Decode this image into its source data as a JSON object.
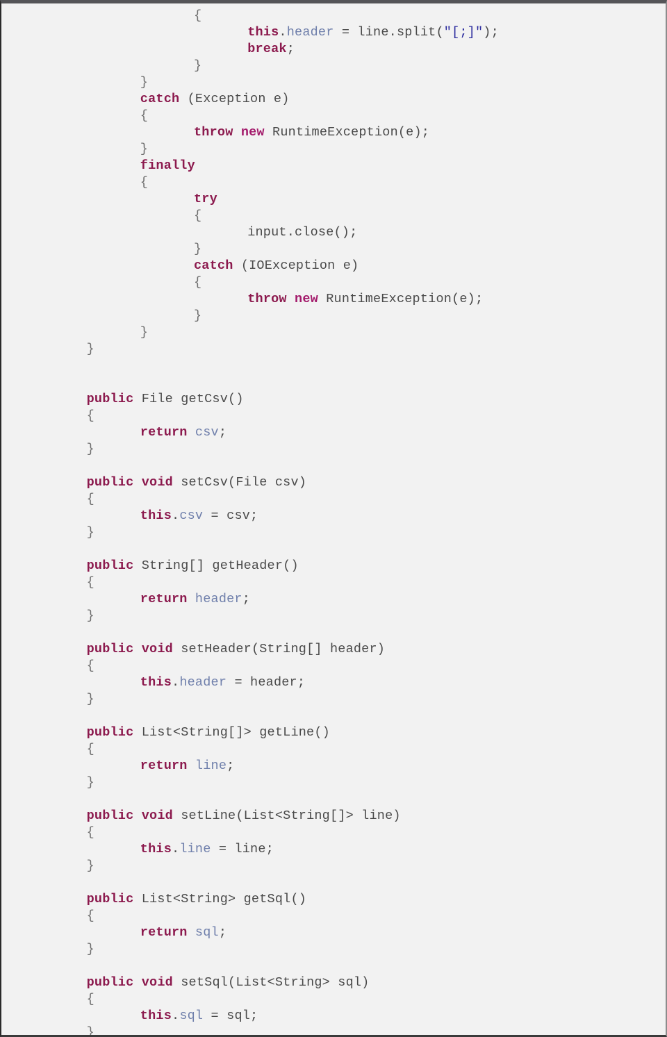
{
  "document": {
    "kind": "source-code-listing",
    "language": "Java",
    "colors": {
      "background": "#f2f2f2",
      "keyword": "#8c1a4e",
      "keyword_alt": "#a31a6b",
      "field": "#6f7fab",
      "string": "#2c2c9e",
      "plain": "#4a4a4a",
      "brace": "#6e6e6e",
      "border_top": "#555558"
    }
  },
  "code": {
    "lines": [
      {
        "indent": 10,
        "tokens": [
          {
            "t": "{",
            "c": "brc"
          }
        ]
      },
      {
        "indent": 14,
        "tokens": [
          {
            "t": "this",
            "c": "kw"
          },
          {
            "t": ".",
            "c": "pln"
          },
          {
            "t": "header",
            "c": "fld"
          },
          {
            "t": " = line.split(",
            "c": "pln"
          },
          {
            "t": "\"[;]\"",
            "c": "str"
          },
          {
            "t": ");",
            "c": "pln"
          }
        ]
      },
      {
        "indent": 14,
        "tokens": [
          {
            "t": "break",
            "c": "kw"
          },
          {
            "t": ";",
            "c": "pln"
          }
        ]
      },
      {
        "indent": 10,
        "tokens": [
          {
            "t": "}",
            "c": "brc"
          }
        ]
      },
      {
        "indent": 6,
        "tokens": [
          {
            "t": "}",
            "c": "brc"
          }
        ]
      },
      {
        "indent": 6,
        "tokens": [
          {
            "t": "catch",
            "c": "kw"
          },
          {
            "t": " (Exception e)",
            "c": "pln"
          }
        ]
      },
      {
        "indent": 6,
        "tokens": [
          {
            "t": "{",
            "c": "brc"
          }
        ]
      },
      {
        "indent": 10,
        "tokens": [
          {
            "t": "throw",
            "c": "kw"
          },
          {
            "t": " ",
            "c": "pln"
          },
          {
            "t": "new",
            "c": "kw2"
          },
          {
            "t": " RuntimeException(e);",
            "c": "pln"
          }
        ]
      },
      {
        "indent": 6,
        "tokens": [
          {
            "t": "}",
            "c": "brc"
          }
        ]
      },
      {
        "indent": 6,
        "tokens": [
          {
            "t": "finally",
            "c": "kw"
          }
        ]
      },
      {
        "indent": 6,
        "tokens": [
          {
            "t": "{",
            "c": "brc"
          }
        ]
      },
      {
        "indent": 10,
        "tokens": [
          {
            "t": "try",
            "c": "kw"
          }
        ]
      },
      {
        "indent": 10,
        "tokens": [
          {
            "t": "{",
            "c": "brc"
          }
        ]
      },
      {
        "indent": 14,
        "tokens": [
          {
            "t": "input.close();",
            "c": "pln"
          }
        ]
      },
      {
        "indent": 10,
        "tokens": [
          {
            "t": "}",
            "c": "brc"
          }
        ]
      },
      {
        "indent": 10,
        "tokens": [
          {
            "t": "catch",
            "c": "kw"
          },
          {
            "t": " (IOException e)",
            "c": "pln"
          }
        ]
      },
      {
        "indent": 10,
        "tokens": [
          {
            "t": "{",
            "c": "brc"
          }
        ]
      },
      {
        "indent": 14,
        "tokens": [
          {
            "t": "throw",
            "c": "kw"
          },
          {
            "t": " ",
            "c": "pln"
          },
          {
            "t": "new",
            "c": "kw2"
          },
          {
            "t": " RuntimeException(e);",
            "c": "pln"
          }
        ]
      },
      {
        "indent": 10,
        "tokens": [
          {
            "t": "}",
            "c": "brc"
          }
        ]
      },
      {
        "indent": 6,
        "tokens": [
          {
            "t": "}",
            "c": "brc"
          }
        ]
      },
      {
        "indent": 2,
        "tokens": [
          {
            "t": "}",
            "c": "brc"
          }
        ]
      },
      {
        "indent": 0,
        "tokens": []
      },
      {
        "indent": 0,
        "tokens": []
      },
      {
        "indent": 2,
        "tokens": [
          {
            "t": "public",
            "c": "kw"
          },
          {
            "t": " File getCsv()",
            "c": "typ"
          }
        ]
      },
      {
        "indent": 2,
        "tokens": [
          {
            "t": "{",
            "c": "brc"
          }
        ]
      },
      {
        "indent": 6,
        "tokens": [
          {
            "t": "return",
            "c": "kw"
          },
          {
            "t": " ",
            "c": "pln"
          },
          {
            "t": "csv",
            "c": "fld"
          },
          {
            "t": ";",
            "c": "pln"
          }
        ]
      },
      {
        "indent": 2,
        "tokens": [
          {
            "t": "}",
            "c": "brc"
          }
        ]
      },
      {
        "indent": 0,
        "tokens": []
      },
      {
        "indent": 2,
        "tokens": [
          {
            "t": "public",
            "c": "kw"
          },
          {
            "t": " ",
            "c": "pln"
          },
          {
            "t": "void",
            "c": "kw"
          },
          {
            "t": " setCsv(File csv)",
            "c": "typ"
          }
        ]
      },
      {
        "indent": 2,
        "tokens": [
          {
            "t": "{",
            "c": "brc"
          }
        ]
      },
      {
        "indent": 6,
        "tokens": [
          {
            "t": "this",
            "c": "kw"
          },
          {
            "t": ".",
            "c": "pln"
          },
          {
            "t": "csv",
            "c": "fld"
          },
          {
            "t": " = csv;",
            "c": "pln"
          }
        ]
      },
      {
        "indent": 2,
        "tokens": [
          {
            "t": "}",
            "c": "brc"
          }
        ]
      },
      {
        "indent": 0,
        "tokens": []
      },
      {
        "indent": 2,
        "tokens": [
          {
            "t": "public",
            "c": "kw"
          },
          {
            "t": " String[] getHeader()",
            "c": "typ"
          }
        ]
      },
      {
        "indent": 2,
        "tokens": [
          {
            "t": "{",
            "c": "brc"
          }
        ]
      },
      {
        "indent": 6,
        "tokens": [
          {
            "t": "return",
            "c": "kw"
          },
          {
            "t": " ",
            "c": "pln"
          },
          {
            "t": "header",
            "c": "fld"
          },
          {
            "t": ";",
            "c": "pln"
          }
        ]
      },
      {
        "indent": 2,
        "tokens": [
          {
            "t": "}",
            "c": "brc"
          }
        ]
      },
      {
        "indent": 0,
        "tokens": []
      },
      {
        "indent": 2,
        "tokens": [
          {
            "t": "public",
            "c": "kw"
          },
          {
            "t": " ",
            "c": "pln"
          },
          {
            "t": "void",
            "c": "kw"
          },
          {
            "t": " setHeader(String[] header)",
            "c": "typ"
          }
        ]
      },
      {
        "indent": 2,
        "tokens": [
          {
            "t": "{",
            "c": "brc"
          }
        ]
      },
      {
        "indent": 6,
        "tokens": [
          {
            "t": "this",
            "c": "kw"
          },
          {
            "t": ".",
            "c": "pln"
          },
          {
            "t": "header",
            "c": "fld"
          },
          {
            "t": " = header;",
            "c": "pln"
          }
        ]
      },
      {
        "indent": 2,
        "tokens": [
          {
            "t": "}",
            "c": "brc"
          }
        ]
      },
      {
        "indent": 0,
        "tokens": []
      },
      {
        "indent": 2,
        "tokens": [
          {
            "t": "public",
            "c": "kw"
          },
          {
            "t": " List<String[]> getLine()",
            "c": "typ"
          }
        ]
      },
      {
        "indent": 2,
        "tokens": [
          {
            "t": "{",
            "c": "brc"
          }
        ]
      },
      {
        "indent": 6,
        "tokens": [
          {
            "t": "return",
            "c": "kw"
          },
          {
            "t": " ",
            "c": "pln"
          },
          {
            "t": "line",
            "c": "fld"
          },
          {
            "t": ";",
            "c": "pln"
          }
        ]
      },
      {
        "indent": 2,
        "tokens": [
          {
            "t": "}",
            "c": "brc"
          }
        ]
      },
      {
        "indent": 0,
        "tokens": []
      },
      {
        "indent": 2,
        "tokens": [
          {
            "t": "public",
            "c": "kw"
          },
          {
            "t": " ",
            "c": "pln"
          },
          {
            "t": "void",
            "c": "kw"
          },
          {
            "t": " setLine(List<String[]> line)",
            "c": "typ"
          }
        ]
      },
      {
        "indent": 2,
        "tokens": [
          {
            "t": "{",
            "c": "brc"
          }
        ]
      },
      {
        "indent": 6,
        "tokens": [
          {
            "t": "this",
            "c": "kw"
          },
          {
            "t": ".",
            "c": "pln"
          },
          {
            "t": "line",
            "c": "fld"
          },
          {
            "t": " = line;",
            "c": "pln"
          }
        ]
      },
      {
        "indent": 2,
        "tokens": [
          {
            "t": "}",
            "c": "brc"
          }
        ]
      },
      {
        "indent": 0,
        "tokens": []
      },
      {
        "indent": 2,
        "tokens": [
          {
            "t": "public",
            "c": "kw"
          },
          {
            "t": " List<String> getSql()",
            "c": "typ"
          }
        ]
      },
      {
        "indent": 2,
        "tokens": [
          {
            "t": "{",
            "c": "brc"
          }
        ]
      },
      {
        "indent": 6,
        "tokens": [
          {
            "t": "return",
            "c": "kw"
          },
          {
            "t": " ",
            "c": "pln"
          },
          {
            "t": "sql",
            "c": "fld"
          },
          {
            "t": ";",
            "c": "pln"
          }
        ]
      },
      {
        "indent": 2,
        "tokens": [
          {
            "t": "}",
            "c": "brc"
          }
        ]
      },
      {
        "indent": 0,
        "tokens": []
      },
      {
        "indent": 2,
        "tokens": [
          {
            "t": "public",
            "c": "kw"
          },
          {
            "t": " ",
            "c": "pln"
          },
          {
            "t": "void",
            "c": "kw"
          },
          {
            "t": " setSql(List<String> sql)",
            "c": "typ"
          }
        ]
      },
      {
        "indent": 2,
        "tokens": [
          {
            "t": "{",
            "c": "brc"
          }
        ]
      },
      {
        "indent": 6,
        "tokens": [
          {
            "t": "this",
            "c": "kw"
          },
          {
            "t": ".",
            "c": "pln"
          },
          {
            "t": "sql",
            "c": "fld"
          },
          {
            "t": " = sql;",
            "c": "pln"
          }
        ]
      },
      {
        "indent": 2,
        "tokens": [
          {
            "t": "}",
            "c": "brc"
          }
        ]
      }
    ]
  }
}
